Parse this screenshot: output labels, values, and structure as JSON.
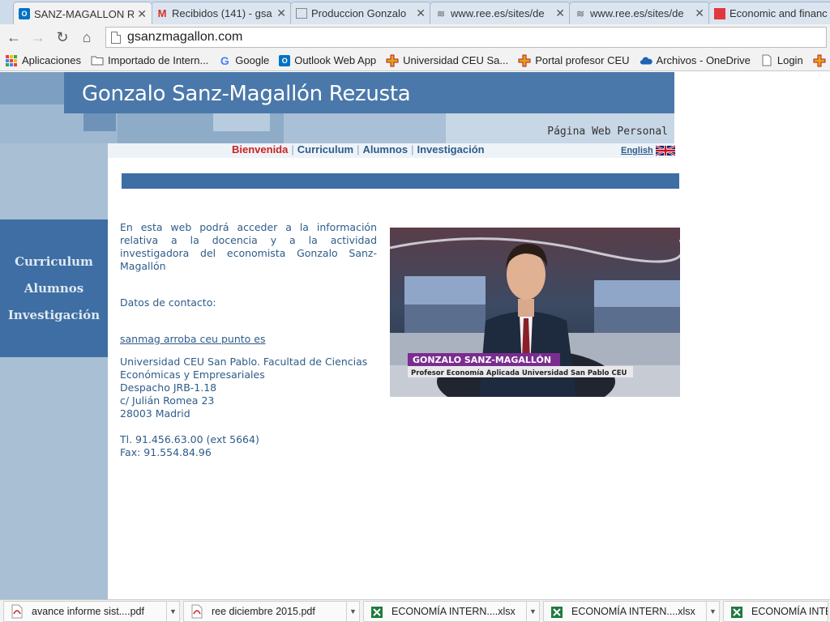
{
  "browser": {
    "tabs": [
      {
        "title": "SANZ-MAGALLON R",
        "icon": "outlook-icon",
        "color": "#0072c6",
        "active": true
      },
      {
        "title": "Recibidos (141) - gsa",
        "icon": "gmail-icon",
        "color": "#d93025",
        "active": false
      },
      {
        "title": "Produccion Gonzalo",
        "icon": "page-icon",
        "color": "#777777",
        "active": false
      },
      {
        "title": "www.ree.es/sites/de",
        "icon": "ree-icon",
        "color": "#777777",
        "active": false
      },
      {
        "title": "www.ree.es/sites/de",
        "icon": "ree-icon",
        "color": "#777777",
        "active": false
      },
      {
        "title": "Economic and financ",
        "icon": "red-square-icon",
        "color": "#e0383e",
        "active": false
      }
    ],
    "address": "gsanzmagallon.com",
    "bookmarks": [
      {
        "label": "Aplicaciones",
        "icon": "apps-grid-icon"
      },
      {
        "label": "Importado de Intern...",
        "icon": "folder-icon"
      },
      {
        "label": "Google",
        "icon": "google-icon"
      },
      {
        "label": "Outlook Web App",
        "icon": "outlook-icon"
      },
      {
        "label": "Universidad CEU Sa...",
        "icon": "ceu-cross-icon"
      },
      {
        "label": "Portal profesor CEU",
        "icon": "ceu-cross-icon"
      },
      {
        "label": "Archivos - OneDrive",
        "icon": "onedrive-icon"
      },
      {
        "label": "Login",
        "icon": "page-icon"
      }
    ],
    "downloads": [
      {
        "label": "avance informe sist....pdf",
        "icon": "pdf-icon"
      },
      {
        "label": "ree diciembre 2015.pdf",
        "icon": "pdf-icon"
      },
      {
        "label": "ECONOMÍA INTERN....xlsx",
        "icon": "excel-icon"
      },
      {
        "label": "ECONOMÍA INTERN....xlsx",
        "icon": "excel-icon"
      },
      {
        "label": "ECONOMÍA INTE",
        "icon": "excel-icon"
      }
    ]
  },
  "site": {
    "title": "Gonzalo Sanz-Magallón Rezusta",
    "subtitle": "Página Web Personal",
    "nav": {
      "bienvenida": "Bienvenida",
      "curriculum": "Curriculum",
      "alumnos": "Alumnos",
      "investigacion": "Investigación",
      "english": "English"
    },
    "side_menu": {
      "curriculum": "Curriculum",
      "alumnos": "Alumnos",
      "investigacion": "Investigación"
    },
    "intro": "En esta web podrá acceder a la información relativa a la docencia y a la actividad investigadora del economista Gonzalo Sanz-Magallón",
    "contact_label": "Datos de contacto:",
    "email": "sanmag arroba ceu punto es",
    "address": {
      "line1": "Universidad CEU San Pablo. Facultad de Ciencias",
      "line2": "Económicas y Empresariales",
      "line3": "Despacho JRB-1.18",
      "line4": "c/ Julián Romea 23",
      "line5": "28003 Madrid"
    },
    "phone": "Tl. 91.456.63.00 (ext 5664)",
    "fax": "Fax: 91.554.84.96",
    "photo": {
      "caption_name": "GONZALO SANZ-MAGALLÓN",
      "caption_role": "Profesor Economía Aplicada Universidad San Pablo CEU"
    },
    "colors": {
      "accent": "#3e6ea3",
      "link": "#2e5c8a",
      "current": "#cc2222"
    }
  }
}
